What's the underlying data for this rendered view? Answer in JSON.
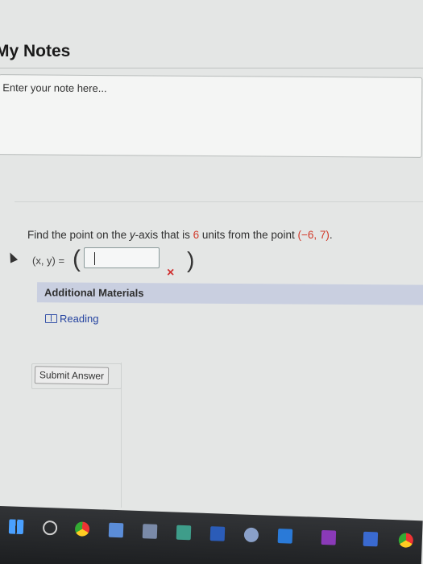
{
  "notes": {
    "title": "My Notes",
    "placeholder": "Enter your note here..."
  },
  "question": {
    "prefix": "Find the point on the ",
    "axis": "y",
    "middle": "-axis that is ",
    "distance": "6",
    "suffix": " units from the point ",
    "point": "(−6, 7)",
    "end": ".",
    "answer_label": "(x, y) =",
    "answer_value": "",
    "paren_open": "(",
    "paren_close": ")",
    "wrong_mark": "×"
  },
  "materials": {
    "header": "Additional Materials",
    "reading": "Reading"
  },
  "actions": {
    "submit_label": "Submit Answer"
  },
  "taskbar": {
    "icons": [
      "windows-icon",
      "cortana-icon",
      "chrome-icon",
      "file-icon",
      "file-icon",
      "app-icon",
      "word-icon",
      "steam-icon",
      "outlook-icon",
      "onenote-icon",
      "app-icon",
      "chrome-icon"
    ]
  },
  "colors": {
    "accent_red": "#d23a2a",
    "link_blue": "#2443a0",
    "materials_bar": "#c9cfe0"
  }
}
